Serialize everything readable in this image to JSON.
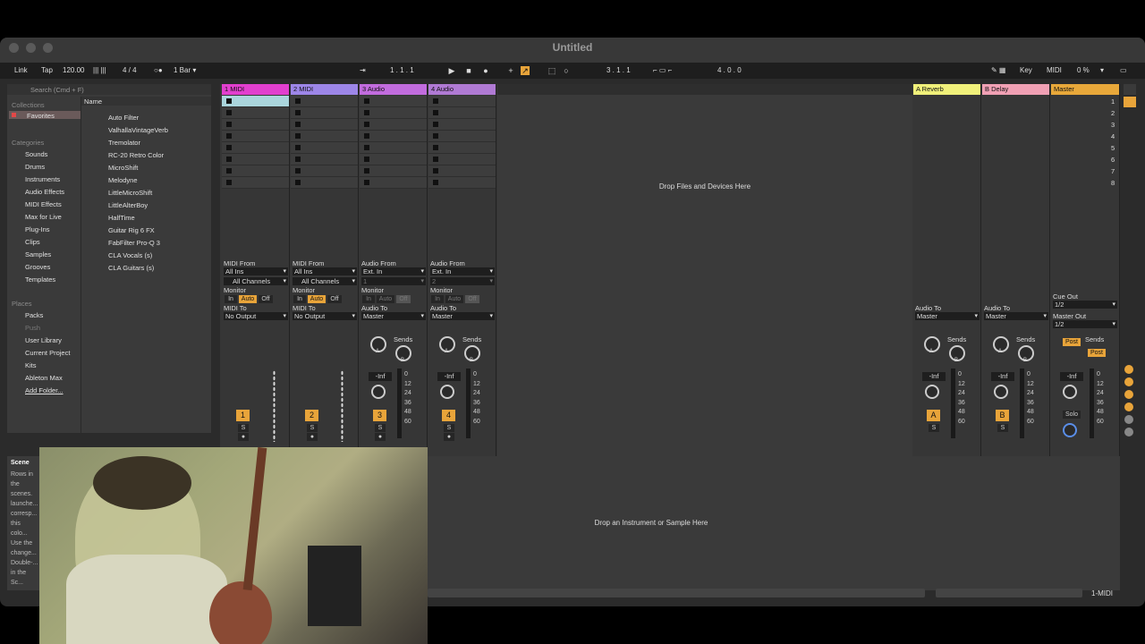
{
  "window": {
    "title": "Untitled"
  },
  "control_bar": {
    "link": "Link",
    "tap": "Tap",
    "tempo": "120.00",
    "signature": "4 / 4",
    "quantize": "1 Bar",
    "position": "1 .   1 .   1",
    "loop_start": "3 .   1 .   1",
    "loop_length": "4 .   0 .   0",
    "key": "Key",
    "midi": "MIDI",
    "cpu": "0 %"
  },
  "browser": {
    "search_placeholder": "Search (Cmd + F)",
    "collections_header": "Collections",
    "favorites": "Favorites",
    "name_header": "Name",
    "categories_header": "Categories",
    "categories": [
      "Sounds",
      "Drums",
      "Instruments",
      "Audio Effects",
      "MIDI Effects",
      "Max for Live",
      "Plug-Ins",
      "Clips",
      "Samples",
      "Grooves",
      "Templates"
    ],
    "places_header": "Places",
    "places": [
      "Packs",
      "Push",
      "User Library",
      "Current Project",
      "Kits",
      "Ableton Max",
      "Add Folder..."
    ],
    "items": [
      "Auto Filter",
      "ValhallaVintageVerb",
      "Tremolator",
      "RC-20 Retro Color",
      "MicroShift",
      "Melodyne",
      "LittleMicroShift",
      "LittleAlterBoy",
      "HalfTime",
      "Guitar Rig 6 FX",
      "FabFilter Pro-Q 3",
      "CLA Vocals (s)",
      "CLA Guitars (s)"
    ]
  },
  "tracks": [
    {
      "name": "1 MIDI",
      "color": "#e23fce",
      "input_label": "MIDI From",
      "input": "All Ins",
      "channel": "All Channels",
      "monitor": "Monitor",
      "m_in": "In",
      "m_auto": "Auto",
      "m_off": "Off",
      "output_label": "MIDI To",
      "output": "No Output",
      "number": "1",
      "solo": "S"
    },
    {
      "name": "2 MIDI",
      "color": "#9d86e8",
      "input_label": "MIDI From",
      "input": "All Ins",
      "channel": "All Channels",
      "monitor": "Monitor",
      "m_in": "In",
      "m_auto": "Auto",
      "m_off": "Off",
      "output_label": "MIDI To",
      "output": "No Output",
      "number": "2",
      "solo": "S"
    },
    {
      "name": "3 Audio",
      "color": "#c26cde",
      "input_label": "Audio From",
      "input": "Ext. In",
      "channel": "1",
      "monitor": "Monitor",
      "m_in": "In",
      "m_auto": "Auto",
      "m_off": "Off",
      "output_label": "Audio To",
      "output": "Master",
      "number": "3",
      "solo": "S",
      "sends": "Sends",
      "vol": "-Inf"
    },
    {
      "name": "4 Audio",
      "color": "#b07ad4",
      "input_label": "Audio From",
      "input": "Ext. In",
      "channel": "2",
      "monitor": "Monitor",
      "m_in": "In",
      "m_auto": "Auto",
      "m_off": "Off",
      "output_label": "Audio To",
      "output": "Master",
      "number": "4",
      "solo": "S",
      "sends": "Sends",
      "vol": "-Inf"
    }
  ],
  "returns": [
    {
      "name": "A Reverb",
      "color": "#f0f07a",
      "output_label": "Audio To",
      "output": "Master",
      "letter": "A",
      "solo": "S",
      "sends": "Sends",
      "vol": "-Inf"
    },
    {
      "name": "B Delay",
      "color": "#f0a0b4",
      "output_label": "Audio To",
      "output": "Master",
      "letter": "B",
      "solo": "S",
      "sends": "Sends",
      "vol": "-Inf"
    }
  ],
  "master": {
    "name": "Master",
    "color": "#e8a83a",
    "scenes": [
      "1",
      "2",
      "3",
      "4",
      "5",
      "6",
      "7",
      "8"
    ],
    "cue_label": "Cue Out",
    "cue": "1/2",
    "out_label": "Master Out",
    "out": "1/2",
    "sends": "Sends",
    "post": "Post",
    "vol": "-Inf",
    "solo": "Solo"
  },
  "meter_scale": "0\n12\n24\n36\n48\n60",
  "send_labels": {
    "a": "A",
    "b": "B"
  },
  "drop_files": "Drop Files and Devices Here",
  "drop_instrument": "Drop an Instrument or Sample Here",
  "info": {
    "title": "Scene",
    "text": "Rows in the scenes. launche... corresp... this colo... Use the change... Double-... in the Sc..."
  },
  "status": {
    "track": "1-MIDI"
  }
}
